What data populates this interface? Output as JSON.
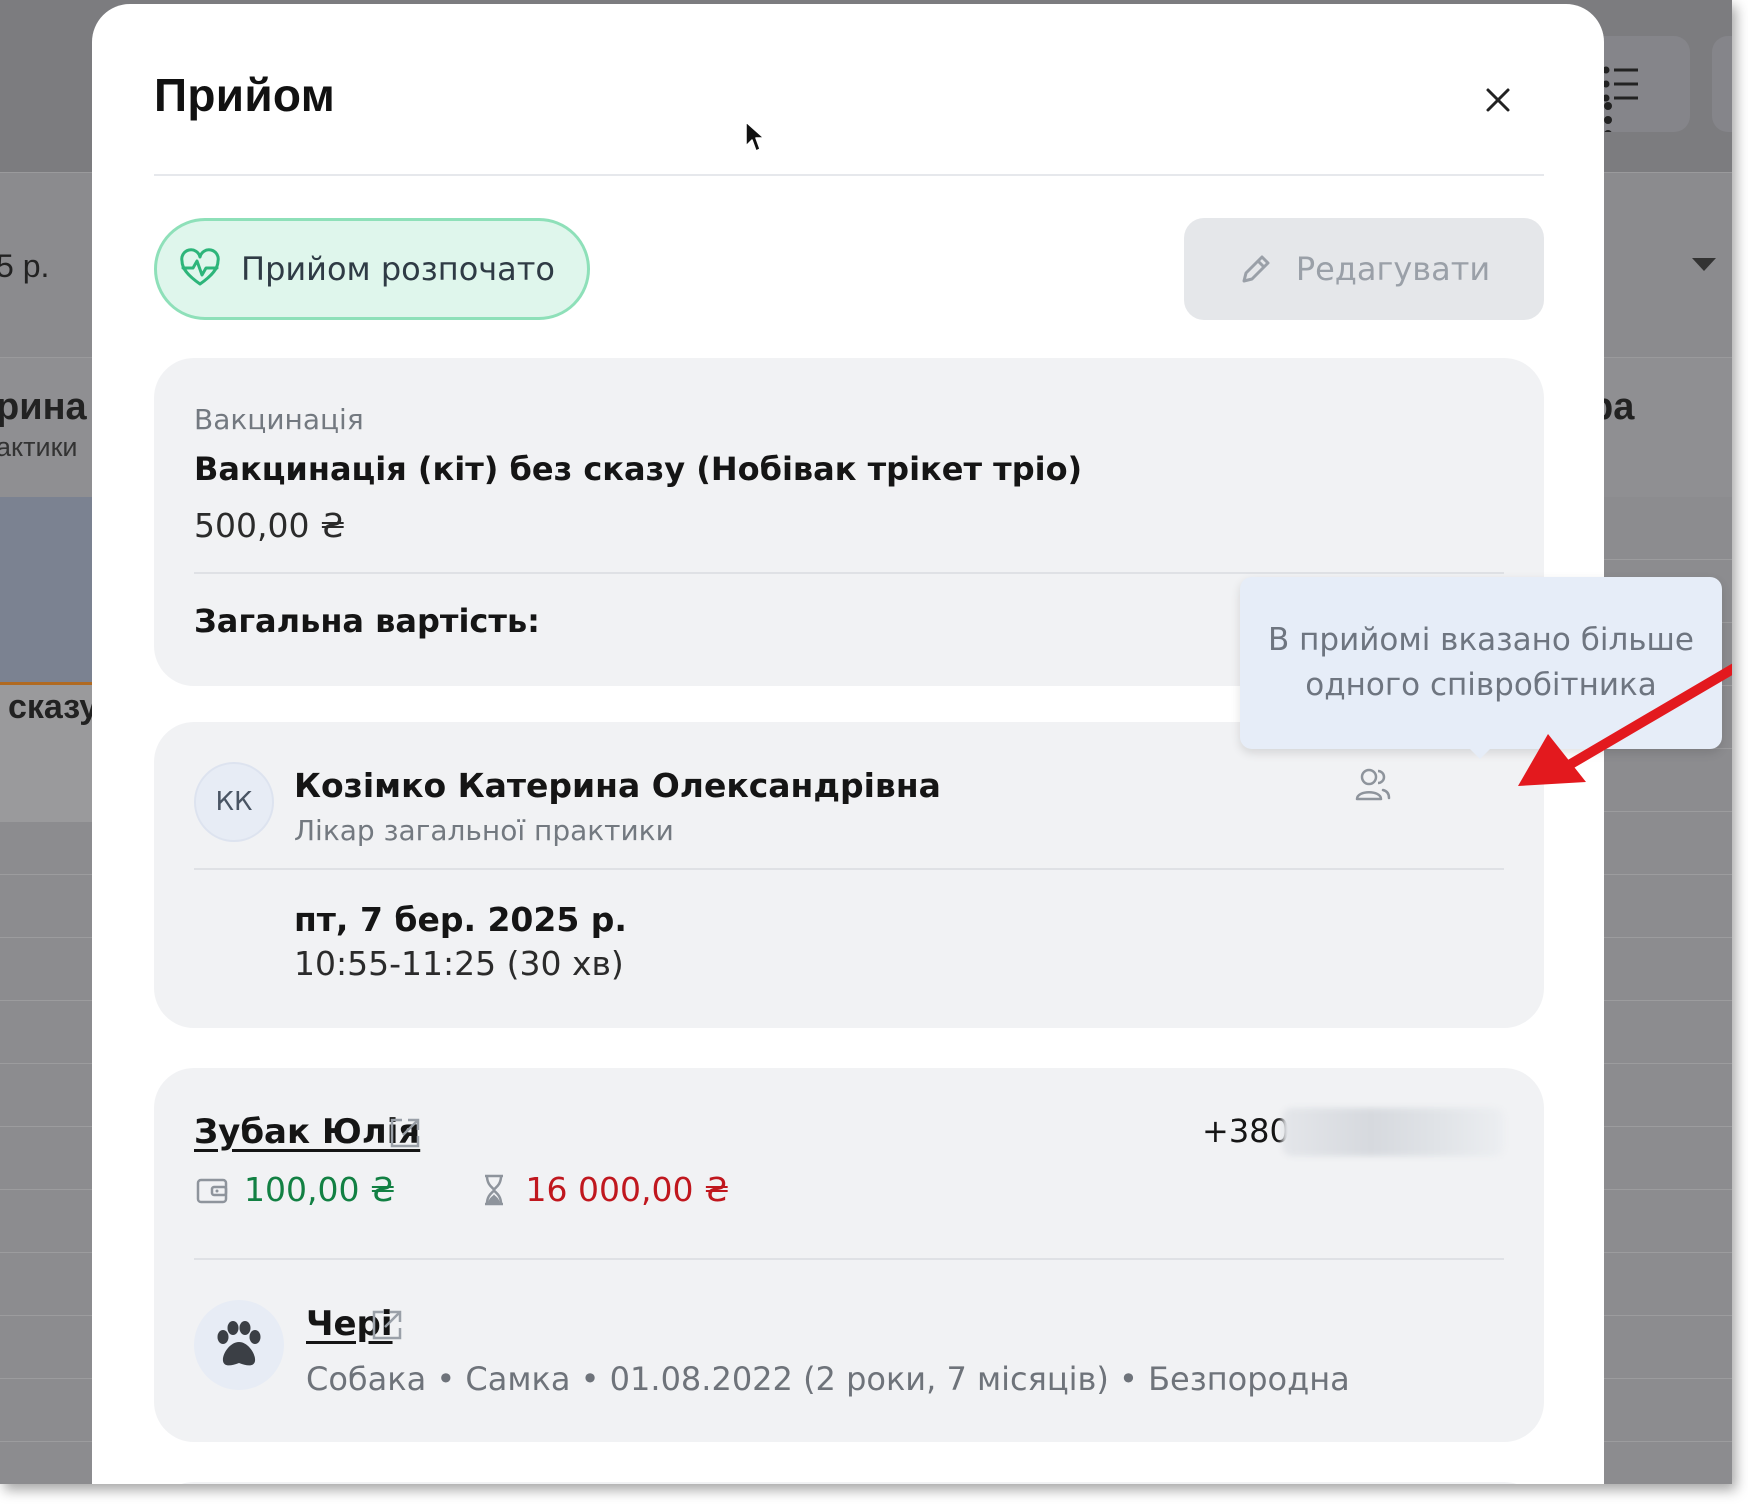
{
  "background": {
    "date_fragment": "5 р.",
    "name_fragment_left": "рина",
    "role_fragment_left": "актики",
    "name_fragment_right": "ра",
    "event_fragment": "сказу"
  },
  "modal": {
    "title": "Прийом",
    "close_icon": "close-icon",
    "status": {
      "label": "Прийом розпочато",
      "icon": "heart-pulse-icon",
      "color": "#2db57a"
    },
    "edit_button": {
      "label": "Редагувати",
      "icon": "pencil-icon"
    }
  },
  "service": {
    "category": "Вакцинація",
    "name": "Вакцинація (кіт) без сказу (Нобівак трікет тріо)",
    "price": "500,00 ₴",
    "total_label": "Загальна вартість:"
  },
  "staff": {
    "initials": "КК",
    "name": "Козімко Катерина Олександрівна",
    "role": "Лікар загальної практики",
    "multi_icon": "users-icon",
    "date": "пт, 7 бер. 2025 р.",
    "time": "10:55-11:25 (30 хв)"
  },
  "tooltip": {
    "text": "В прийомі вказано більше одного співробітника"
  },
  "client": {
    "name": "Зубак Юлія",
    "phone_prefix": "+380",
    "balance": "100,00 ₴",
    "balance_color": "#128043",
    "debt": "16 000,00 ₴",
    "debt_color": "#c0171e",
    "wallet_icon": "wallet-icon",
    "hourglass_icon": "hourglass-icon"
  },
  "pet": {
    "name": "Чері",
    "avatar_icon": "paw-icon",
    "details": "Собака • Самка • 01.08.2022 (2 роки, 7 місяців) • Безпородна"
  }
}
